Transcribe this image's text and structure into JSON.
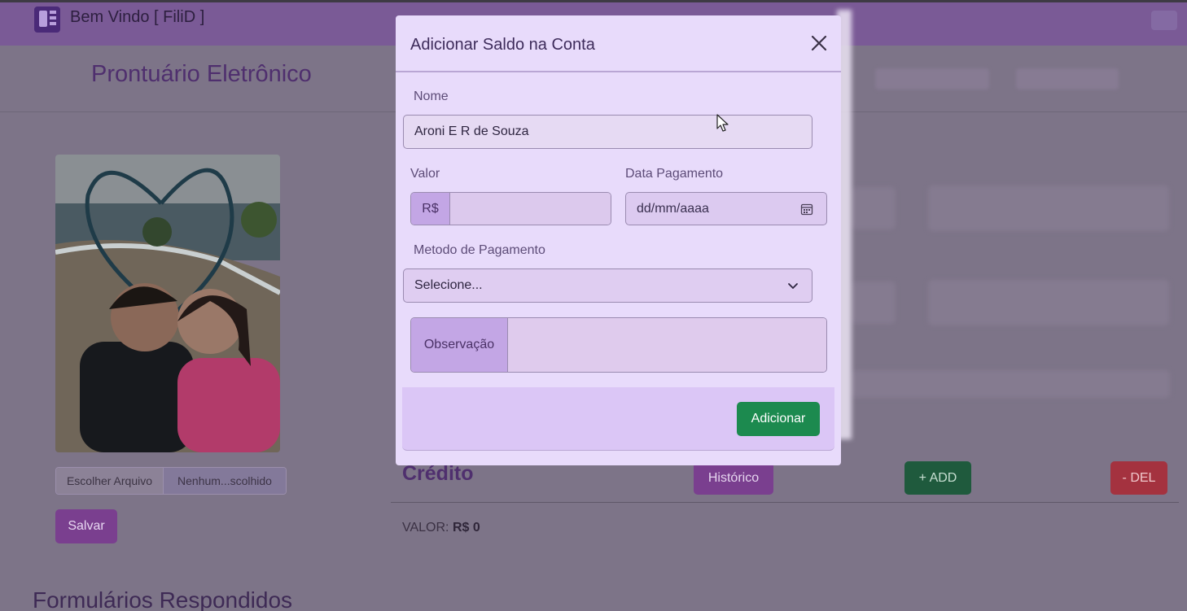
{
  "header": {
    "welcome_text": "Bem Vindo [ FiliD ]"
  },
  "page": {
    "title": "Prontuário Eletrônico",
    "file_input": {
      "button_label": "Escolher Arquivo",
      "file_name": "Nenhum...scolhido"
    },
    "save_label": "Salvar",
    "forms_title": "Formulários Respondidos"
  },
  "credit": {
    "title": "Crédito",
    "history_label": "Histórico",
    "add_label": "+ ADD",
    "del_label": "- DEL",
    "value_label": "VALOR:",
    "value": "R$ 0"
  },
  "modal": {
    "title": "Adicionar Saldo na Conta",
    "name_label": "Nome",
    "name_value": "Aroni E R de Souza",
    "value_label": "Valor",
    "currency_addon": "R$",
    "date_label": "Data Pagamento",
    "date_placeholder": "dd/mm/aaaa",
    "payment_method_label": "Metodo de Pagamento",
    "payment_method_selected": "Selecione...",
    "note_addon": "Observação",
    "submit_label": "Adicionar"
  },
  "colors": {
    "modal_bg": "#e8dbfb",
    "primary_purple": "#7a3f8f",
    "success_green": "#1c8a4f",
    "danger_red": "#a4323f"
  }
}
